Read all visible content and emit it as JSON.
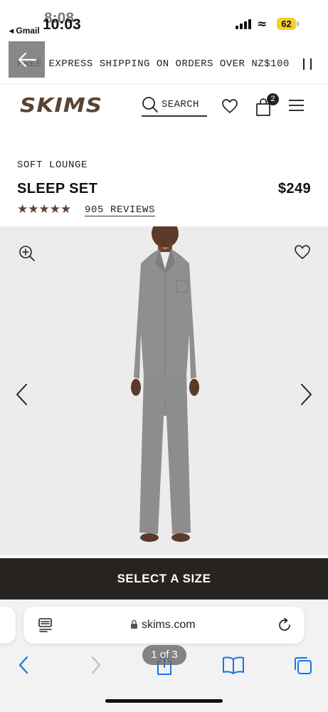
{
  "status_bar": {
    "time_behind": "8:08",
    "time": "10:03",
    "back_app": "◂ Gmail",
    "battery": "62",
    "colors": {
      "battery": "#f6cf2b"
    }
  },
  "promo": {
    "text": "FREE EXPRESS SHIPPING ON ORDERS OVER NZ$100",
    "pause_icon": "pause-icon"
  },
  "header": {
    "logo": "SKIMS",
    "search_label": "SEARCH",
    "bag_count": "2",
    "icons": [
      "search-icon",
      "heart-icon",
      "bag-icon",
      "menu-icon"
    ],
    "colors": {
      "logo": "#5a4233"
    }
  },
  "product": {
    "collection": "SOFT LOUNGE",
    "title": "SLEEP SET",
    "price": "$249",
    "rating": 5,
    "stars": "★★★★★",
    "reviews": "905 REVIEWS"
  },
  "gallery": {
    "icons": [
      "zoom-in-icon",
      "wishlist-heart-icon",
      "chevron-left-icon",
      "chevron-right-icon"
    ]
  },
  "cta": {
    "label": "SELECT A SIZE",
    "colors": {
      "background": "#262320"
    }
  },
  "browser": {
    "url": "skims.com",
    "page_indicator": "1 of 3",
    "icons": [
      "reader-icon",
      "lock-icon",
      "reload-icon",
      "back-icon",
      "forward-icon",
      "share-icon",
      "bookmarks-icon",
      "tabs-icon"
    ],
    "colors": {
      "accent": "#1a73e8"
    }
  }
}
